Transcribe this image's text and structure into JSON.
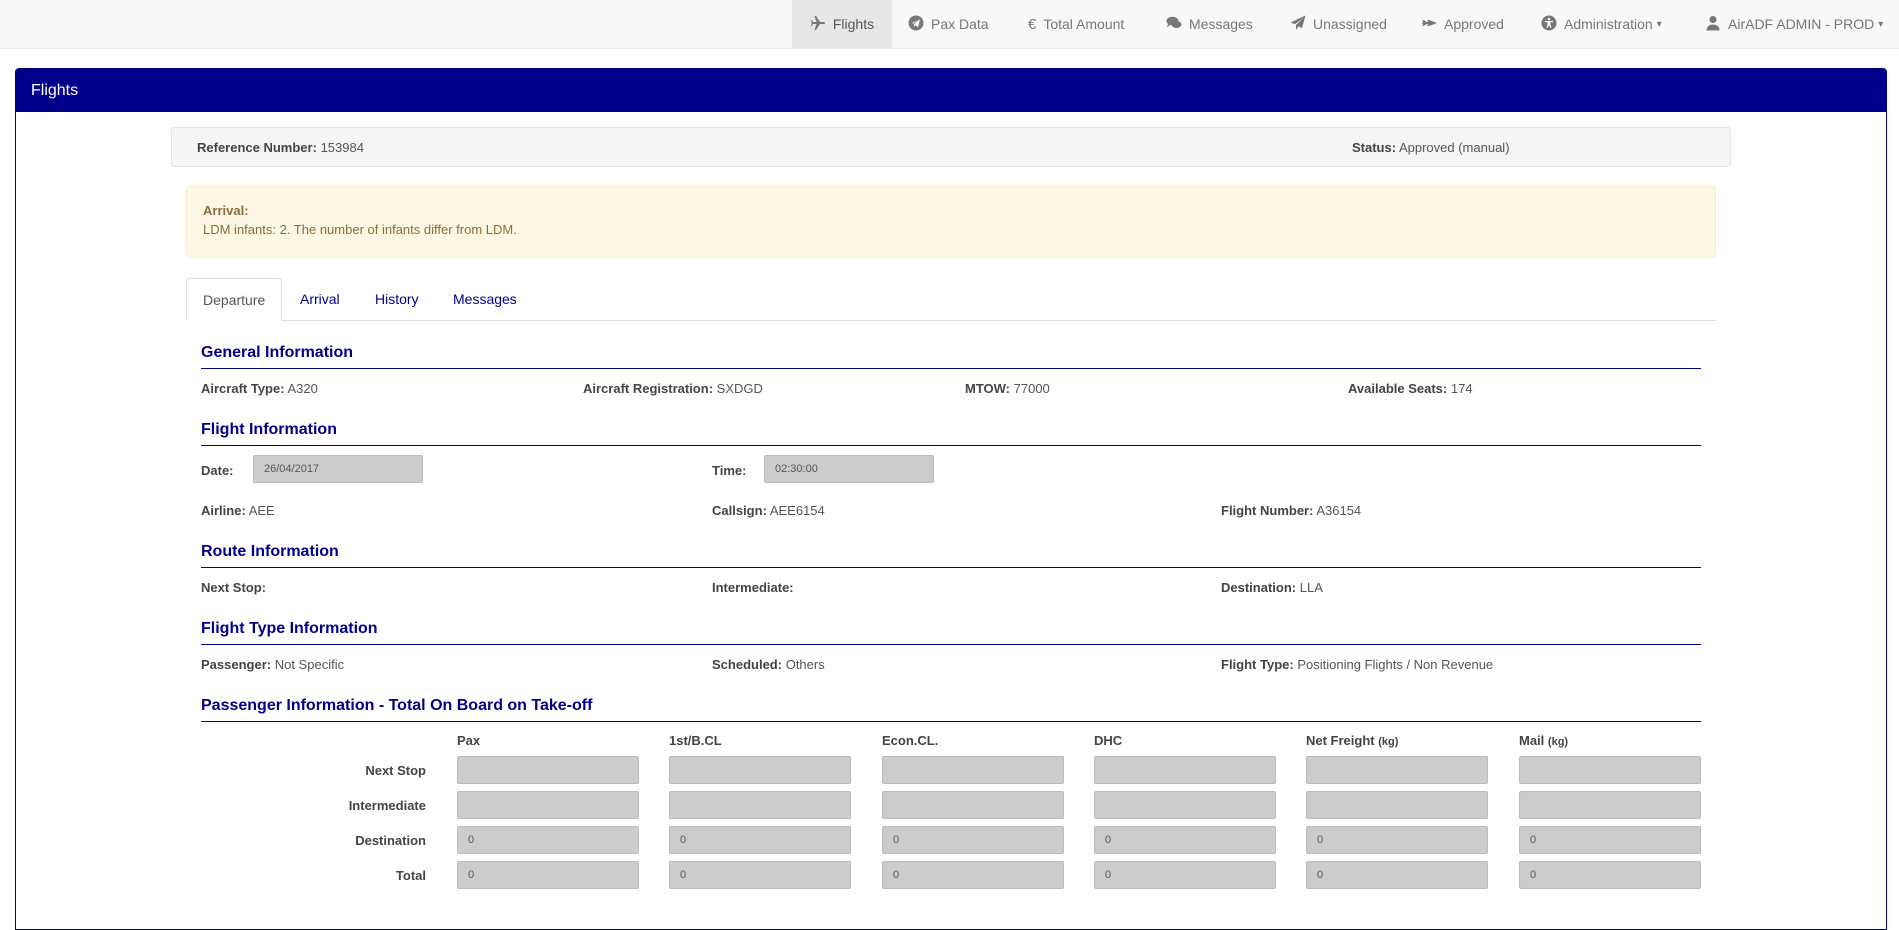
{
  "nav": {
    "items": [
      {
        "label": "Flights",
        "icon": "plane-icon"
      },
      {
        "label": "Pax Data",
        "icon": "paper-plane-icon"
      },
      {
        "label": "Total Amount",
        "icon": "euro-icon"
      },
      {
        "label": "Messages",
        "icon": "comments-icon"
      },
      {
        "label": "Unassigned",
        "icon": "send-icon"
      },
      {
        "label": "Approved",
        "icon": "fighter-jet-icon"
      },
      {
        "label": "Administration",
        "icon": "universal-access-icon"
      },
      {
        "label": "AirADF ADMIN - PROD",
        "icon": "user-icon"
      }
    ]
  },
  "panel": {
    "title": "Flights"
  },
  "reference": {
    "label": "Reference Number:",
    "value": "153984"
  },
  "status": {
    "label": "Status:",
    "value": "Approved (manual)"
  },
  "alert": {
    "title": "Arrival:",
    "message": "LDM infants: 2. The number of infants differ from LDM."
  },
  "tabs": [
    "Departure",
    "Arrival",
    "History",
    "Messages"
  ],
  "general": {
    "title": "General Information",
    "aircraft_type": {
      "label": "Aircraft Type:",
      "value": "A320"
    },
    "aircraft_registration": {
      "label": "Aircraft Registration:",
      "value": "SXDGD"
    },
    "mtow": {
      "label": "MTOW:",
      "value": "77000"
    },
    "available_seats": {
      "label": "Available Seats:",
      "value": "174"
    }
  },
  "flight": {
    "title": "Flight Information",
    "date": {
      "label": "Date:",
      "value": "26/04/2017"
    },
    "time": {
      "label": "Time:",
      "value": "02:30:00"
    },
    "airline": {
      "label": "Airline:",
      "value": "AEE"
    },
    "callsign": {
      "label": "Callsign:",
      "value": "AEE6154"
    },
    "flight_number": {
      "label": "Flight Number:",
      "value": "A36154"
    }
  },
  "route": {
    "title": "Route Information",
    "next_stop": {
      "label": "Next Stop:",
      "value": ""
    },
    "intermediate": {
      "label": "Intermediate:",
      "value": ""
    },
    "destination": {
      "label": "Destination:",
      "value": "LLA"
    }
  },
  "flight_type": {
    "title": "Flight Type Information",
    "passenger": {
      "label": "Passenger:",
      "value": "Not Specific"
    },
    "scheduled": {
      "label": "Scheduled:",
      "value": "Others"
    },
    "flight_type": {
      "label": "Flight Type:",
      "value": "Positioning Flights / Non Revenue"
    }
  },
  "passengers": {
    "title": "Passenger Information - Total On Board on Take-off",
    "columns": [
      {
        "label": "Pax",
        "unit": ""
      },
      {
        "label": "1st/B.CL",
        "unit": ""
      },
      {
        "label": "Econ.CL.",
        "unit": ""
      },
      {
        "label": "DHC",
        "unit": ""
      },
      {
        "label": "Net Freight",
        "unit": "(kg)"
      },
      {
        "label": "Mail",
        "unit": "(kg)"
      }
    ],
    "rows": [
      {
        "label": "Next Stop",
        "values": [
          "",
          "",
          "",
          "",
          "",
          ""
        ]
      },
      {
        "label": "Intermediate",
        "values": [
          "",
          "",
          "",
          "",
          "",
          ""
        ]
      },
      {
        "label": "Destination",
        "values": [
          "0",
          "0",
          "0",
          "0",
          "0",
          "0"
        ]
      },
      {
        "label": "Total",
        "values": [
          "0",
          "0",
          "0",
          "0",
          "0",
          "0"
        ]
      }
    ]
  }
}
